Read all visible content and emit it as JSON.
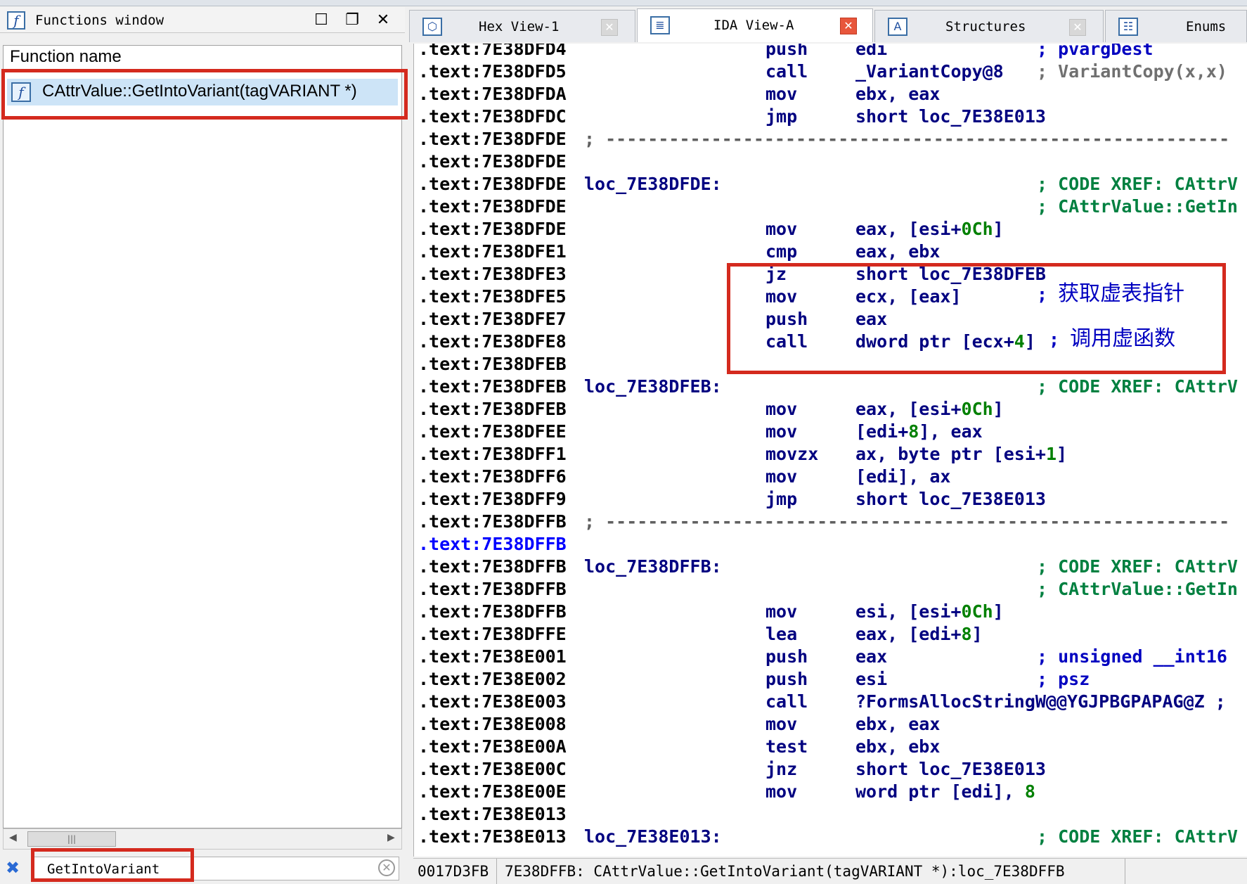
{
  "functions_window": {
    "title": "Functions window",
    "column_header": "Function name",
    "selected_function": "CAttrValue::GetIntoVariant(tagVARIANT *)",
    "filter_text": "GetIntoVariant"
  },
  "tabs": [
    {
      "label": "Hex View-1",
      "active": false,
      "close": "gray"
    },
    {
      "label": "IDA View-A",
      "active": true,
      "close": "red"
    },
    {
      "label": "Structures",
      "active": false,
      "close": "gray"
    },
    {
      "label": "Enums",
      "active": false,
      "close": "none"
    }
  ],
  "disasm": [
    {
      "addr": ".text:7E38DFD4",
      "mn": "push",
      "op": "edi",
      "cm": "; pvargDest",
      "cm_type": "normal"
    },
    {
      "addr": ".text:7E38DFD5",
      "mn": "call",
      "op": "_VariantCopy@8",
      "cm": "; VariantCopy(x,x)",
      "cm_type": "gray"
    },
    {
      "addr": ".text:7E38DFDA",
      "mn": "mov",
      "op": "ebx, eax"
    },
    {
      "addr": ".text:7E38DFDC",
      "mn": "jmp",
      "op": "short loc_7E38E013"
    },
    {
      "addr": ".text:7E38DFDE",
      "sep": "; -----------------------------------------------------------"
    },
    {
      "addr": ".text:7E38DFDE"
    },
    {
      "addr": ".text:7E38DFDE",
      "label": "loc_7E38DFDE:",
      "cm": "; CODE XREF: CAttrV",
      "cm_type": "xref"
    },
    {
      "addr": ".text:7E38DFDE",
      "cm": "; CAttrValue::GetIn",
      "cm_type": "xref"
    },
    {
      "addr": ".text:7E38DFDE",
      "mn": "mov",
      "op": "eax, [esi+",
      "num": "0Ch",
      "op2": "]"
    },
    {
      "addr": ".text:7E38DFE1",
      "mn": "cmp",
      "op": "eax, ebx"
    },
    {
      "addr": ".text:7E38DFE3",
      "mn": "jz",
      "op": "short loc_7E38DFEB"
    },
    {
      "addr": ".text:7E38DFE5",
      "mn": "mov",
      "op": "ecx, [eax]",
      "cm": "; 获取虚表指针",
      "cm_type": "cjk"
    },
    {
      "addr": ".text:7E38DFE7",
      "mn": "push",
      "op": "eax"
    },
    {
      "addr": ".text:7E38DFE8",
      "mn": "call",
      "op": "dword ptr [ecx+",
      "num": "4",
      "op2": "]",
      "cm": " ; 调用虚函数",
      "cm_type": "cjk"
    },
    {
      "addr": ".text:7E38DFEB"
    },
    {
      "addr": ".text:7E38DFEB",
      "label": "loc_7E38DFEB:",
      "cm": "; CODE XREF: CAttrV",
      "cm_type": "xref"
    },
    {
      "addr": ".text:7E38DFEB",
      "mn": "mov",
      "op": "eax, [esi+",
      "num": "0Ch",
      "op2": "]"
    },
    {
      "addr": ".text:7E38DFEE",
      "mn": "mov",
      "op": "[edi+",
      "num": "8",
      "op2": "], eax"
    },
    {
      "addr": ".text:7E38DFF1",
      "mn": "movzx",
      "op": "ax, byte ptr [esi+",
      "num": "1",
      "op2": "]"
    },
    {
      "addr": ".text:7E38DFF6",
      "mn": "mov",
      "op": "[edi], ax"
    },
    {
      "addr": ".text:7E38DFF9",
      "mn": "jmp",
      "op": "short loc_7E38E013"
    },
    {
      "addr": ".text:7E38DFFB",
      "sep": "; -----------------------------------------------------------"
    },
    {
      "addr": ".text:7E38DFFB",
      "selected": true
    },
    {
      "addr": ".text:7E38DFFB",
      "label": "loc_7E38DFFB:",
      "cm": "; CODE XREF: CAttrV",
      "cm_type": "xref"
    },
    {
      "addr": ".text:7E38DFFB",
      "cm": "; CAttrValue::GetIn",
      "cm_type": "xref"
    },
    {
      "addr": ".text:7E38DFFB",
      "mn": "mov",
      "op": "esi, [esi+",
      "num": "0Ch",
      "op2": "]"
    },
    {
      "addr": ".text:7E38DFFE",
      "mn": "lea",
      "op": "eax, [edi+",
      "num": "8",
      "op2": "]"
    },
    {
      "addr": ".text:7E38E001",
      "mn": "push",
      "op": "eax",
      "cm": "; unsigned __int16",
      "cm_type": "normal"
    },
    {
      "addr": ".text:7E38E002",
      "mn": "push",
      "op": "esi",
      "cm": "; psz",
      "cm_type": "normal"
    },
    {
      "addr": ".text:7E38E003",
      "mn": "call",
      "op": "?FormsAllocStringW@@YGJPBGPAPAG@Z ;"
    },
    {
      "addr": ".text:7E38E008",
      "mn": "mov",
      "op": "ebx, eax"
    },
    {
      "addr": ".text:7E38E00A",
      "mn": "test",
      "op": "ebx, ebx"
    },
    {
      "addr": ".text:7E38E00C",
      "mn": "jnz",
      "op": "short loc_7E38E013"
    },
    {
      "addr": ".text:7E38E00E",
      "mn": "mov",
      "op": "word ptr [edi], ",
      "num": "8"
    },
    {
      "addr": ".text:7E38E013"
    },
    {
      "addr": ".text:7E38E013",
      "label": "loc_7E38E013:",
      "cm": "; CODE XREF: CAttrV",
      "cm_type": "xref"
    }
  ],
  "status": {
    "offset": "0017D3FB",
    "location": "7E38DFFB: CAttrValue::GetIntoVariant(tagVARIANT *):loc_7E38DFFB"
  },
  "colors": {
    "highlight": "#d42a1e",
    "selection": "#cde4f7",
    "code": "#000080",
    "xref": "#008040"
  }
}
